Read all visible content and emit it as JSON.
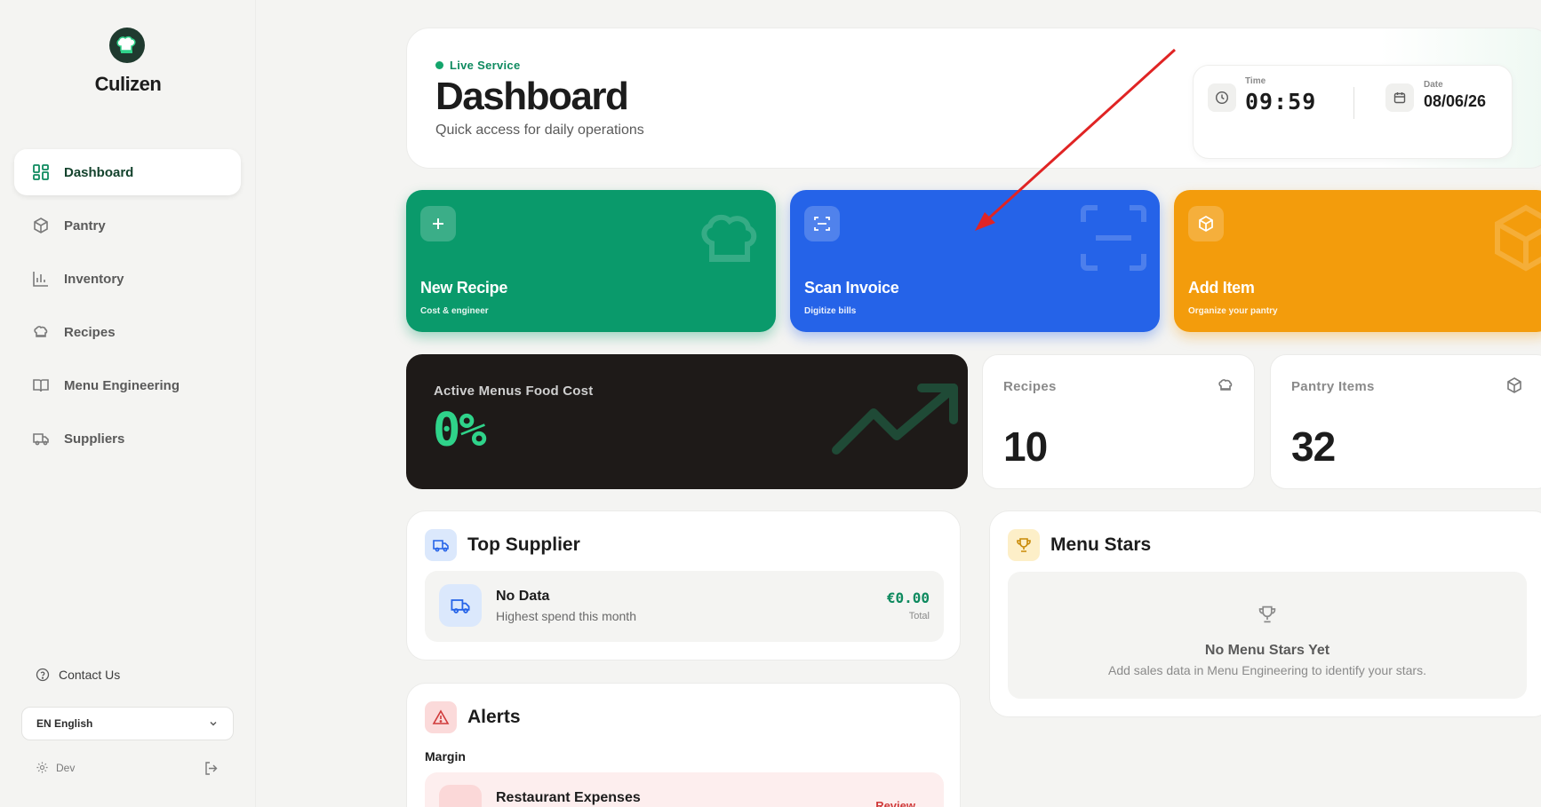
{
  "brand": {
    "name": "Culizen"
  },
  "sidebar": {
    "items": [
      {
        "label": "Dashboard",
        "icon": "dashboard-icon",
        "active": true
      },
      {
        "label": "Pantry",
        "icon": "box-icon"
      },
      {
        "label": "Inventory",
        "icon": "bar-chart-icon"
      },
      {
        "label": "Recipes",
        "icon": "chef-hat-icon"
      },
      {
        "label": "Menu Engineering",
        "icon": "book-icon"
      },
      {
        "label": "Suppliers",
        "icon": "truck-icon"
      }
    ],
    "contact_label": "Contact Us",
    "language": "EN English",
    "dev_label": "Dev"
  },
  "header": {
    "status": "Live Service",
    "title": "Dashboard",
    "subtitle": "Quick access for daily operations",
    "time_label": "Time",
    "time_value": "09:59",
    "date_label": "Date",
    "date_value": "08/06/26"
  },
  "actions": [
    {
      "title": "New Recipe",
      "subtitle": "Cost & engineer",
      "color": "#0a9a6b"
    },
    {
      "title": "Scan Invoice",
      "subtitle": "Digitize bills",
      "color": "#2563e8"
    },
    {
      "title": "Add Item",
      "subtitle": "Organize your pantry",
      "color": "#f39c0c"
    }
  ],
  "food_cost": {
    "label": "Active Menus Food Cost",
    "value": "0%"
  },
  "stats": {
    "recipes": {
      "label": "Recipes",
      "value": "10"
    },
    "pantry": {
      "label": "Pantry Items",
      "value": "32"
    }
  },
  "top_supplier": {
    "title": "Top Supplier",
    "name": "No Data",
    "desc": "Highest spend this month",
    "amount": "€0.00",
    "amount_label": "Total"
  },
  "menu_stars": {
    "title": "Menu Stars",
    "empty_title": "No Menu Stars Yet",
    "empty_desc": "Add sales data in Menu Engineering to identify your stars."
  },
  "alerts": {
    "title": "Alerts",
    "section": "Margin",
    "item_name": "Restaurant Expenses",
    "item_action": "Review"
  },
  "colors": {
    "accent": "#0e8a5f",
    "annotation": "#e02424"
  }
}
